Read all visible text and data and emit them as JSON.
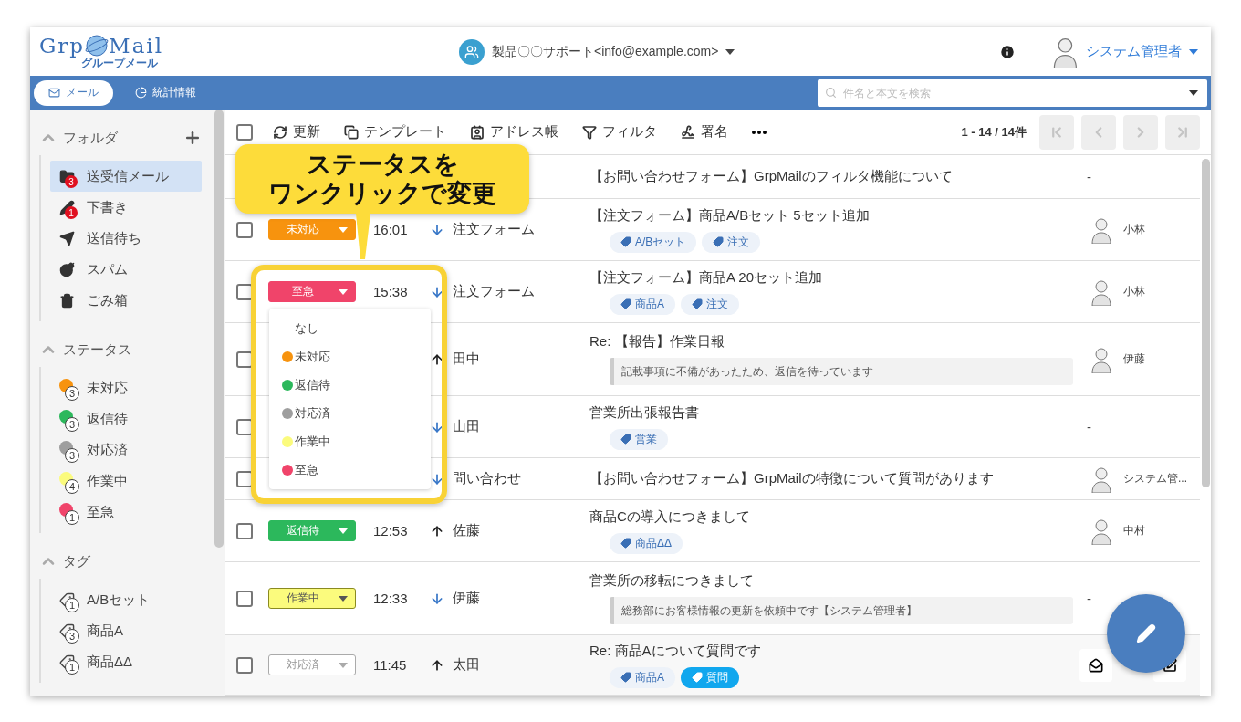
{
  "header": {
    "logo": {
      "left": "Grp",
      "right": "Mail",
      "sub": "グループメール"
    },
    "account": "製品〇〇サポート<info@example.com>",
    "user": "システム管理者"
  },
  "nav": {
    "tabs": [
      {
        "label": "メール",
        "kind": "mail",
        "selected": true
      },
      {
        "label": "統計情報",
        "kind": "stats",
        "selected": false
      }
    ],
    "search": {
      "placeholder": "件名と本文を検索"
    }
  },
  "sidebar": {
    "sections": [
      {
        "title": "フォルダ",
        "kind": "folders",
        "expanded": true,
        "items": [
          {
            "label": "送受信メール",
            "kind": "inbox",
            "badge": "3",
            "selected": true
          },
          {
            "label": "下書き",
            "kind": "draft",
            "badge": "1",
            "selected": false
          },
          {
            "label": "送信待ち",
            "kind": "outbox",
            "selected": false
          },
          {
            "label": "スパム",
            "kind": "spam",
            "selected": false
          },
          {
            "label": "ごみ箱",
            "kind": "trash",
            "selected": false
          }
        ]
      },
      {
        "title": "ステータス",
        "kind": "status",
        "expanded": true,
        "items": [
          {
            "label": "未対応",
            "count": "3",
            "color": "#f7930e"
          },
          {
            "label": "返信待",
            "count": "3",
            "color": "#2cb85c"
          },
          {
            "label": "対応済",
            "count": "3",
            "color": "#9e9e9e"
          },
          {
            "label": "作業中",
            "count": "4",
            "color": "#fbfb7d"
          },
          {
            "label": "至急",
            "count": "1",
            "color": "#f0446a"
          }
        ]
      },
      {
        "title": "タグ",
        "kind": "tags",
        "expanded": true,
        "items": [
          {
            "label": "A/Bセット",
            "count": "1"
          },
          {
            "label": "商品A",
            "count": "3"
          },
          {
            "label": "商品ΔΔ",
            "count": "1"
          }
        ]
      }
    ]
  },
  "toolbar": {
    "checked": false,
    "items": [
      {
        "kind": "refresh",
        "label": "更新"
      },
      {
        "kind": "template",
        "label": "テンプレート"
      },
      {
        "kind": "address",
        "label": "アドレス帳"
      },
      {
        "kind": "filter",
        "label": "フィルタ"
      },
      {
        "kind": "signature",
        "label": "署名"
      },
      {
        "kind": "more"
      }
    ],
    "pagination": {
      "range": "1 - 14 / 14件",
      "buttons": [
        {
          "kind": "first",
          "disabled": true
        },
        {
          "kind": "prev",
          "disabled": true
        },
        {
          "kind": "next",
          "disabled": true
        },
        {
          "kind": "last",
          "disabled": true
        }
      ]
    }
  },
  "rows": [
    {
      "subject": "【お問い合わせフォーム】GrpMailのフィルタ機能について",
      "assignee": {
        "name": "-",
        "avatar": false
      },
      "hovered": false
    },
    {
      "checked": false,
      "status": {
        "label": "未対応",
        "color": "#f7930e",
        "kind": "filled"
      },
      "time": "16:01",
      "outgoing": false,
      "from": "注文フォーム",
      "subject": "【注文フォーム】商品A/Bセット 5セット追加",
      "tags": [
        {
          "label": "A/Bセット",
          "highlighted": false
        },
        {
          "label": "注文",
          "highlighted": false
        }
      ],
      "assignee": {
        "name": "小林",
        "avatar": true
      },
      "hovered": false
    },
    {
      "checked": false,
      "status": {
        "label": "至急",
        "color": "#f0446a",
        "kind": "filled"
      },
      "time": "15:38",
      "outgoing": false,
      "from": "注文フォーム",
      "subject": "【注文フォーム】商品A 20セット追加",
      "tags": [
        {
          "label": "商品A",
          "highlighted": false
        },
        {
          "label": "注文",
          "highlighted": false
        }
      ],
      "assignee": {
        "name": "小林",
        "avatar": true
      },
      "hovered": false
    },
    {
      "checked": false,
      "outgoing": true,
      "from": "田中",
      "subject": "Re: 【報告】作業日報",
      "memo": "記載事項に不備があったため、返信を待っています",
      "assignee": {
        "name": "伊藤",
        "avatar": true
      },
      "hovered": false
    },
    {
      "checked": false,
      "outgoing": false,
      "from": "山田",
      "subject": "営業所出張報告書",
      "tags": [
        {
          "label": "営業",
          "highlighted": false
        }
      ],
      "assignee": {
        "name": "-",
        "avatar": false
      },
      "hovered": false
    },
    {
      "checked": false,
      "outgoing": false,
      "from": "問い合わせ",
      "subject": "【お問い合わせフォーム】GrpMailの特徴について質問があります",
      "assignee": {
        "name": "システム管...",
        "avatar": true
      },
      "hovered": false
    },
    {
      "checked": false,
      "status": {
        "label": "返信待",
        "color": "#2cb85c",
        "kind": "filled"
      },
      "time": "12:53",
      "outgoing": true,
      "from": "佐藤",
      "subject": "商品Cの導入につきまして",
      "tags": [
        {
          "label": "商品ΔΔ",
          "highlighted": false
        }
      ],
      "assignee": {
        "name": "中村",
        "avatar": true
      },
      "hovered": false
    },
    {
      "checked": false,
      "status": {
        "label": "作業中",
        "color": "#fbfb7d",
        "kind": "filled"
      },
      "time": "12:33",
      "outgoing": false,
      "from": "伊藤",
      "subject": "営業所の移転につきまして",
      "memo": "総務部にお客様情報の更新を依頼中です【システム管理者】",
      "assignee": {
        "name": "-",
        "avatar": false
      },
      "hovered": false
    },
    {
      "checked": false,
      "status": {
        "label": "対応済",
        "color": "#9e9e9e",
        "kind": "outline"
      },
      "time": "11:45",
      "outgoing": true,
      "from": "太田",
      "subject": "Re: 商品Aについて質問です",
      "tags": [
        {
          "label": "商品A",
          "highlighted": false
        },
        {
          "label": "質問",
          "highlighted": true
        }
      ],
      "hovered": true
    }
  ],
  "status_menu": {
    "options": [
      {
        "label": "なし"
      },
      {
        "label": "未対応",
        "color": "#f7930e"
      },
      {
        "label": "返信待",
        "color": "#2cb85c"
      },
      {
        "label": "対応済",
        "color": "#9e9e9e"
      },
      {
        "label": "作業中",
        "color": "#fbfb7d"
      },
      {
        "label": "至急",
        "color": "#f0446a"
      }
    ]
  },
  "callout": {
    "lines": [
      "ステータスを",
      "ワンクリックで変更"
    ]
  }
}
